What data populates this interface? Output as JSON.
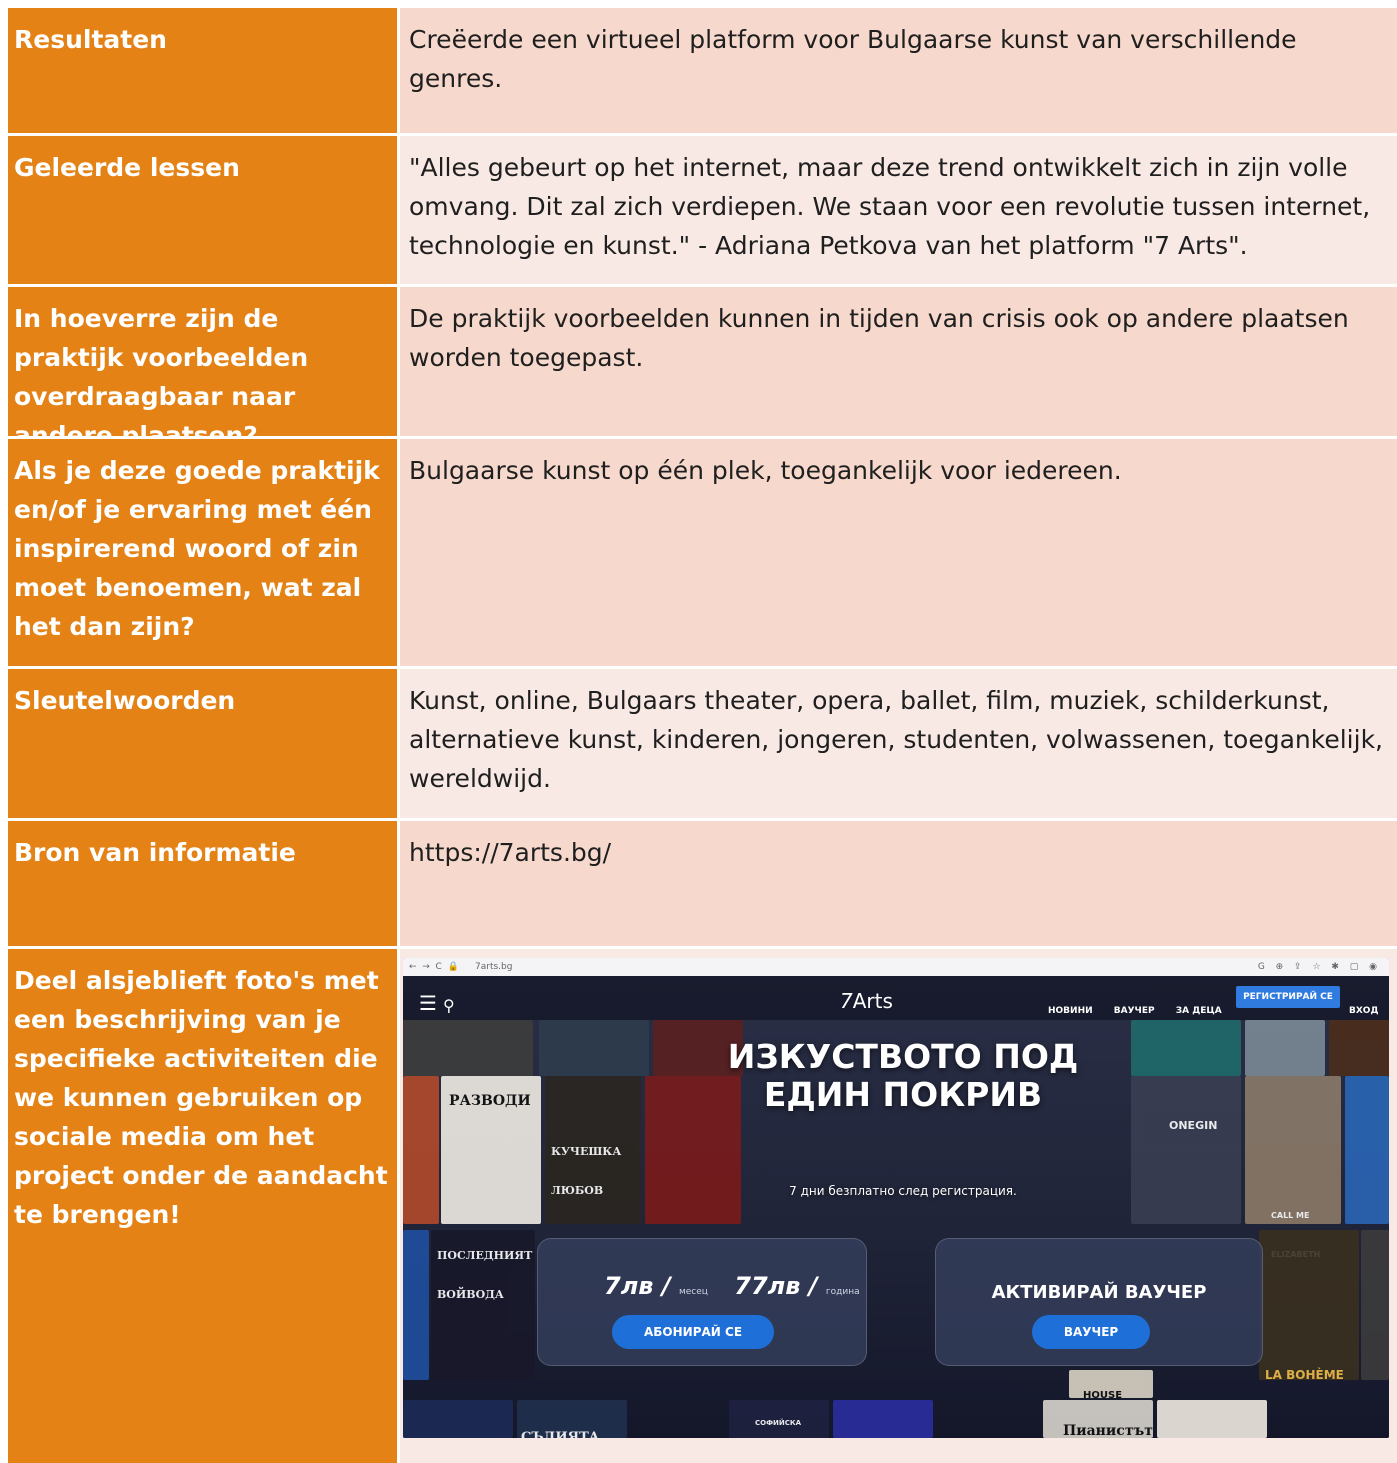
{
  "rows": [
    {
      "label": "Resultaten",
      "text": "Creëerde een virtueel platform voor Bulgaarse kunst van verschillende genres."
    },
    {
      "label": "Geleerde lessen",
      "text": "\"Alles gebeurt op het internet, maar deze trend ontwikkelt zich in zijn volle omvang. Dit zal zich verdiepen. We staan voor een revolutie tussen internet, technologie en kunst.\" - Adriana Petkova van het platform \"7 Arts\"."
    },
    {
      "label": "In hoeverre zijn de praktijk voorbeelden overdraagbaar naar andere plaatsen?",
      "text": "De praktijk voorbeelden kunnen in tijden van crisis ook op andere plaatsen worden toegepast."
    },
    {
      "label": "Als je deze goede praktijk en/of je ervaring met één inspirerend woord of zin moet benoemen, wat zal het dan zijn?",
      "text": "Bulgaarse kunst op één plek, toegankelijk voor iedereen."
    },
    {
      "label": "Sleutelwoorden",
      "text": "Kunst, online, Bulgaars theater, opera, ballet, film, muziek, schilderkunst, alternatieve kunst, kinderen, jongeren, studenten, volwassenen, toegankelijk, wereldwijd."
    },
    {
      "label": "Bron van informatie",
      "text": "https://7arts.bg/"
    },
    {
      "label": "Deel alsjeblieft foto's met een beschrijving van je specifieke activiteiten die we kunnen gebruiken op sociale media om het project onder de aandacht te brengen!",
      "text": ""
    }
  ],
  "screenshot": {
    "browser_url": "7arts.bg",
    "logo_text": "Arts",
    "logo_number": "7",
    "nav": [
      "НОВИНИ",
      "ВАУЧЕР",
      "ЗА ДЕЦА"
    ],
    "register_label": "РЕГИСТРИРАЙ СЕ",
    "login_label": "ВХОД",
    "headline": "ИЗКУСТВОТО ПОД ЕДИН ПОКРИВ",
    "subline": "7 дни безплатно след регистрация.",
    "price_month": "7лв",
    "price_month_unit": "месец",
    "price_year": "77лв",
    "price_year_unit": "година",
    "subscribe_label": "АБОНИРАЙ СЕ",
    "voucher_title": "АКТИВИРАЙ ВАУЧЕР",
    "voucher_button": "ВАУЧЕР",
    "poster_texts": [
      "РАЗВОДИ",
      "КУЧЕШКА ЛЮБОВ",
      "ПОСЛЕДНИЯТ ВОЙВОДА",
      "LA BOHÈME",
      "ONEGIN",
      "CALL ME ELIZABETH",
      "HOUSE",
      "Пианистът",
      "СЪДИЯТА",
      "СОФИЙСКА ОПЕРА И БАЛЕТ"
    ],
    "colors": {
      "orange": "#e48216",
      "rowA": "#f6d8cc",
      "rowB": "#f9e9e4",
      "btnBlue": "#1f6fd8"
    }
  }
}
